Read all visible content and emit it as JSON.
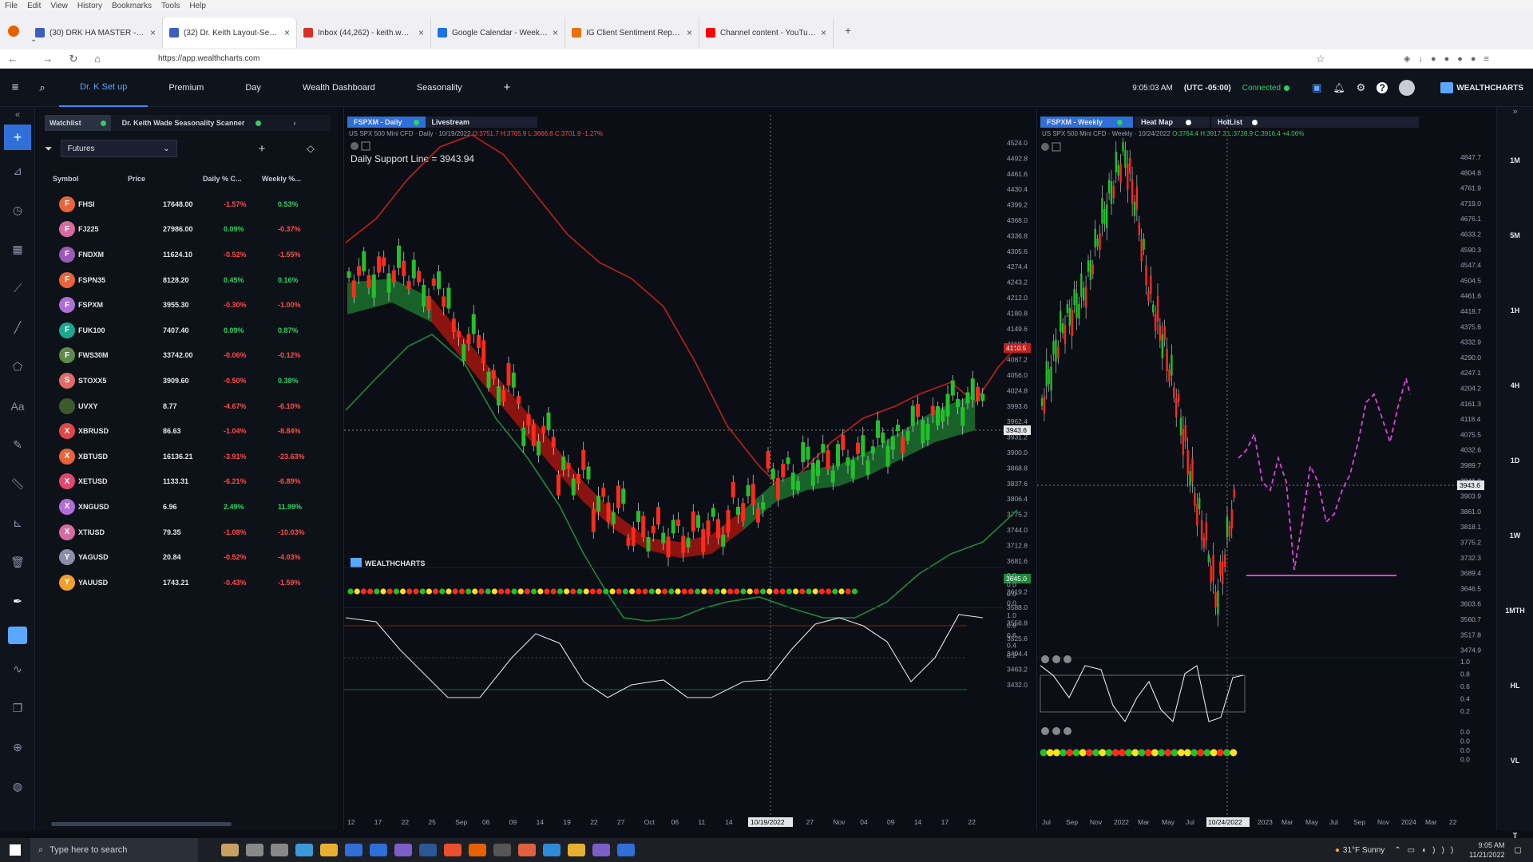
{
  "browser": {
    "menu": [
      "File",
      "Edit",
      "View",
      "History",
      "Bookmarks",
      "Tools",
      "Help"
    ],
    "tabs": [
      {
        "title": "(30) DRK HA MASTER - Wealth",
        "color": "#3a5fbf"
      },
      {
        "title": "(32) Dr. Keith Layout-Seasonal",
        "color": "#3a5fbf",
        "active": true
      },
      {
        "title": "Inbox (44,262) - keith.wade.dba",
        "color": "#d93025"
      },
      {
        "title": "Google Calendar - Week of No",
        "color": "#1a73e8"
      },
      {
        "title": "IG Client Sentiment Report 2022",
        "color": "#e8710a"
      },
      {
        "title": "Channel content - YouTube St",
        "color": "#ff0000"
      }
    ],
    "url": "https://app.wealthcharts.com"
  },
  "app": {
    "tabs": [
      "Dr. K Set up",
      "Premium",
      "Day",
      "Wealth Dashboard",
      "Seasonality"
    ],
    "add": "+",
    "time": "9:05:03 AM",
    "tz": "(UTC -05:00)",
    "status": "Connected",
    "brand": "WEALTHCHARTS",
    "accent": "#3d8bff"
  },
  "watchlist": {
    "tabs": [
      "Watchlist",
      "Dr. Keith Wade Seasonality Scanner"
    ],
    "filter": "Futures",
    "headers": [
      "Symbol",
      "Price",
      "Daily % C...",
      "Weekly %..."
    ],
    "rows": [
      {
        "l": "F",
        "s": "FHSI",
        "p": "17648.00",
        "d": "-1.57%",
        "w": "0.53%",
        "c": "#e8643a"
      },
      {
        "l": "F",
        "s": "FJ225",
        "p": "27986.00",
        "d": "0.09%",
        "w": "-0.37%",
        "c": "#d66ba0"
      },
      {
        "l": "F",
        "s": "FNDXM",
        "p": "11624.10",
        "d": "-0.52%",
        "w": "-1.55%",
        "c": "#9b59b6"
      },
      {
        "l": "F",
        "s": "FSPN35",
        "p": "8128.20",
        "d": "0.45%",
        "w": "0.16%",
        "c": "#e8643a"
      },
      {
        "l": "F",
        "s": "FSPXM",
        "p": "3955.30",
        "d": "-0.30%",
        "w": "-1.00%",
        "c": "#b06fd8"
      },
      {
        "l": "F",
        "s": "FUK100",
        "p": "7407.40",
        "d": "0.09%",
        "w": "0.87%",
        "c": "#1ca78e"
      },
      {
        "l": "F",
        "s": "FWS30M",
        "p": "33742.00",
        "d": "-0.06%",
        "w": "-0.12%",
        "c": "#5e8a4a"
      },
      {
        "l": "S",
        "s": "STOXX5",
        "p": "3909.60",
        "d": "-0.50%",
        "w": "0.38%",
        "c": "#e06b6b"
      },
      {
        "l": "",
        "s": "UVXY",
        "p": "8.77",
        "d": "-4.67%",
        "w": "-6.10%",
        "c": "#3d5a2c"
      },
      {
        "l": "X",
        "s": "XBRUSD",
        "p": "86.63",
        "d": "-1.04%",
        "w": "-8.84%",
        "c": "#e04848"
      },
      {
        "l": "X",
        "s": "XBTUSD",
        "p": "16136.21",
        "d": "-3.91%",
        "w": "-23.63%",
        "c": "#e8643a"
      },
      {
        "l": "X",
        "s": "XETUSD",
        "p": "1133.31",
        "d": "-6.21%",
        "w": "-6.89%",
        "c": "#e04870"
      },
      {
        "l": "X",
        "s": "XNGUSD",
        "p": "6.96",
        "d": "2.49%",
        "w": "11.99%",
        "c": "#b06fd8"
      },
      {
        "l": "X",
        "s": "XTIUSD",
        "p": "79.35",
        "d": "-1.08%",
        "w": "-10.03%",
        "c": "#d66ba0"
      },
      {
        "l": "Y",
        "s": "YAGUSD",
        "p": "20.84",
        "d": "-0.52%",
        "w": "-4.03%",
        "c": "#8a8fa8"
      },
      {
        "l": "Y",
        "s": "YAUUSD",
        "p": "1743.21",
        "d": "-0.43%",
        "w": "-1.59%",
        "c": "#f0a030"
      }
    ]
  },
  "chart_data": [
    {
      "type": "line",
      "tabs": [
        "FSPXM - Daily",
        "Livestream"
      ],
      "subtitle": "US SPX 500 Mini CFD",
      "ohlc_prefix": "· Daily · 10/19/2022",
      "ohlc": "O:3751.7 H:3765.9 L:3666.8 C:3701.9 -1.27%",
      "annotation": "Daily Support Line = 3943.94",
      "yticks": [
        "4524.0",
        "4492.8",
        "4461.6",
        "4430.4",
        "4399.2",
        "4368.0",
        "4336.8",
        "4305.6",
        "4274.4",
        "4243.2",
        "4212.0",
        "4180.8",
        "4149.6",
        "4118.4",
        "4087.2",
        "4056.0",
        "4024.8",
        "3993.6",
        "3962.4",
        "3931.2",
        "3900.0",
        "3868.8",
        "3837.6",
        "3806.4",
        "3775.2",
        "3744.0",
        "3712.8",
        "3681.6",
        "3650.4",
        "3619.2",
        "3588.0",
        "3556.8",
        "3525.6",
        "3494.4",
        "3463.2",
        "3432.0"
      ],
      "price_labels": [
        "4110.5",
        "3943.6",
        "3645.0"
      ],
      "xticks": [
        "12",
        "17",
        "22",
        "25",
        "Sep",
        "06",
        "09",
        "14",
        "19",
        "22",
        "27",
        "Oct",
        "06",
        "11",
        "14",
        "19",
        "24",
        "27",
        "Nov",
        "04",
        "09",
        "14",
        "17",
        "22"
      ],
      "cursor_date": "10/19/2022",
      "brand": "WEALTHCHARTS",
      "osc1_ticks": [
        "0.0",
        "0.0",
        "0.0",
        "0.0"
      ],
      "osc2_ticks": [
        "1.0",
        "0.8",
        "0.6",
        "0.4",
        "0.2"
      ]
    },
    {
      "type": "line",
      "tabs": [
        "FSPXM - Weekly",
        "Heat Map",
        "HotList"
      ],
      "subtitle": "US SPX 500 Mini CFD",
      "ohlc_prefix": "· Weekly · 10/24/2022",
      "ohlc": "O:3764.4 H:3917.3 L:3728.9 C:3916.4 +4.06%",
      "yticks": [
        "4847.7",
        "4804.8",
        "4761.9",
        "4719.0",
        "4676.1",
        "4633.2",
        "4590.3",
        "4547.4",
        "4504.5",
        "4461.6",
        "4418.7",
        "4375.8",
        "4332.9",
        "4290.0",
        "4247.1",
        "4204.2",
        "4161.3",
        "4118.4",
        "4075.5",
        "4032.6",
        "3989.7",
        "3946.8",
        "3903.9",
        "3861.0",
        "3818.1",
        "3775.2",
        "3732.3",
        "3689.4",
        "3646.5",
        "3603.6",
        "3560.7",
        "3517.8",
        "3474.9"
      ],
      "price_label": "3943.6",
      "xticks": [
        "Jul",
        "Sep",
        "Nov",
        "2022",
        "Mar",
        "May",
        "Jul",
        "Sep",
        "Nov",
        "2023",
        "Mar",
        "May",
        "Jul",
        "Sep",
        "Nov",
        "2024",
        "Mar",
        "22"
      ],
      "cursor_date": "10/24/2022",
      "osc1_ticks": [
        "1.0",
        "0.8",
        "0.6",
        "0.4",
        "0.2"
      ],
      "osc2_ticks": [
        "0.0",
        "0.0",
        "0.0",
        "0.0"
      ],
      "projection_color": "#e040e0"
    }
  ],
  "timeframes": [
    "1M",
    "5M",
    "1H",
    "4H",
    "1D",
    "1W",
    "1MTH",
    "HL",
    "VL",
    "T"
  ],
  "taskbar": {
    "search": "Type here to search",
    "weather": "31°F  Sunny",
    "time": "9:05 AM",
    "date": "11/21/2022"
  }
}
